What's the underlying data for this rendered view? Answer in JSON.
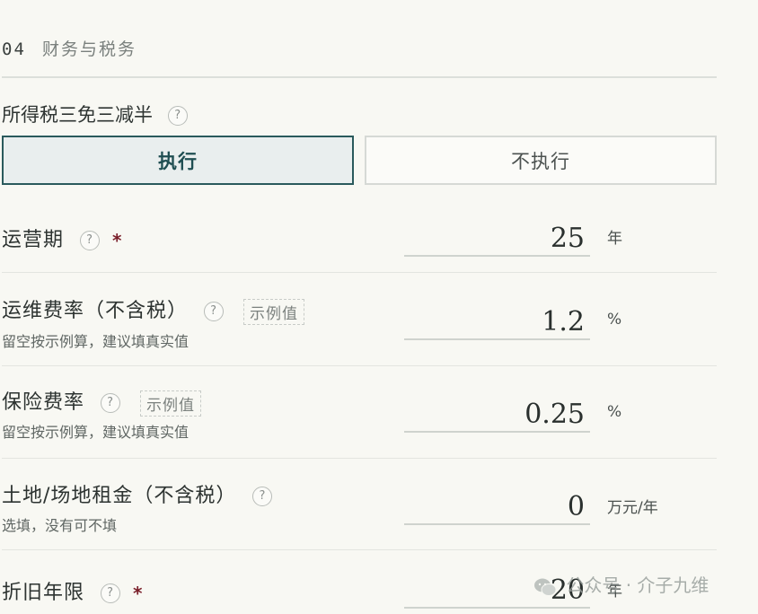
{
  "section": {
    "number": "04",
    "title": "财务与税务"
  },
  "income_tax_toggle": {
    "label": "所得税三免三减半",
    "help": "?",
    "options": [
      "执行",
      "不执行"
    ],
    "selected": "执行"
  },
  "fields": {
    "operation_period": {
      "label": "运营期",
      "help": "?",
      "required": "*",
      "value": "25",
      "unit": "年"
    },
    "om_rate": {
      "label": "运维费率（不含税）",
      "help": "?",
      "example_tag": "示例值",
      "hint": "留空按示例算，建议填真实值",
      "value": "1.2",
      "unit": "%"
    },
    "insurance_rate": {
      "label": "保险费率",
      "help": "?",
      "example_tag": "示例值",
      "hint": "留空按示例算，建议填真实值",
      "value": "0.25",
      "unit": "%"
    },
    "land_rent": {
      "label": "土地/场地租金（不含税）",
      "help": "?",
      "hint": "选填，没有可不填",
      "value": "0",
      "unit": "万元/年"
    },
    "depreciation_years": {
      "label": "折旧年限",
      "help": "?",
      "required": "*",
      "value": "20",
      "unit": "年"
    }
  },
  "watermark": {
    "text": "公众号 · 介子九维",
    "icon": "wechat-icon"
  }
}
